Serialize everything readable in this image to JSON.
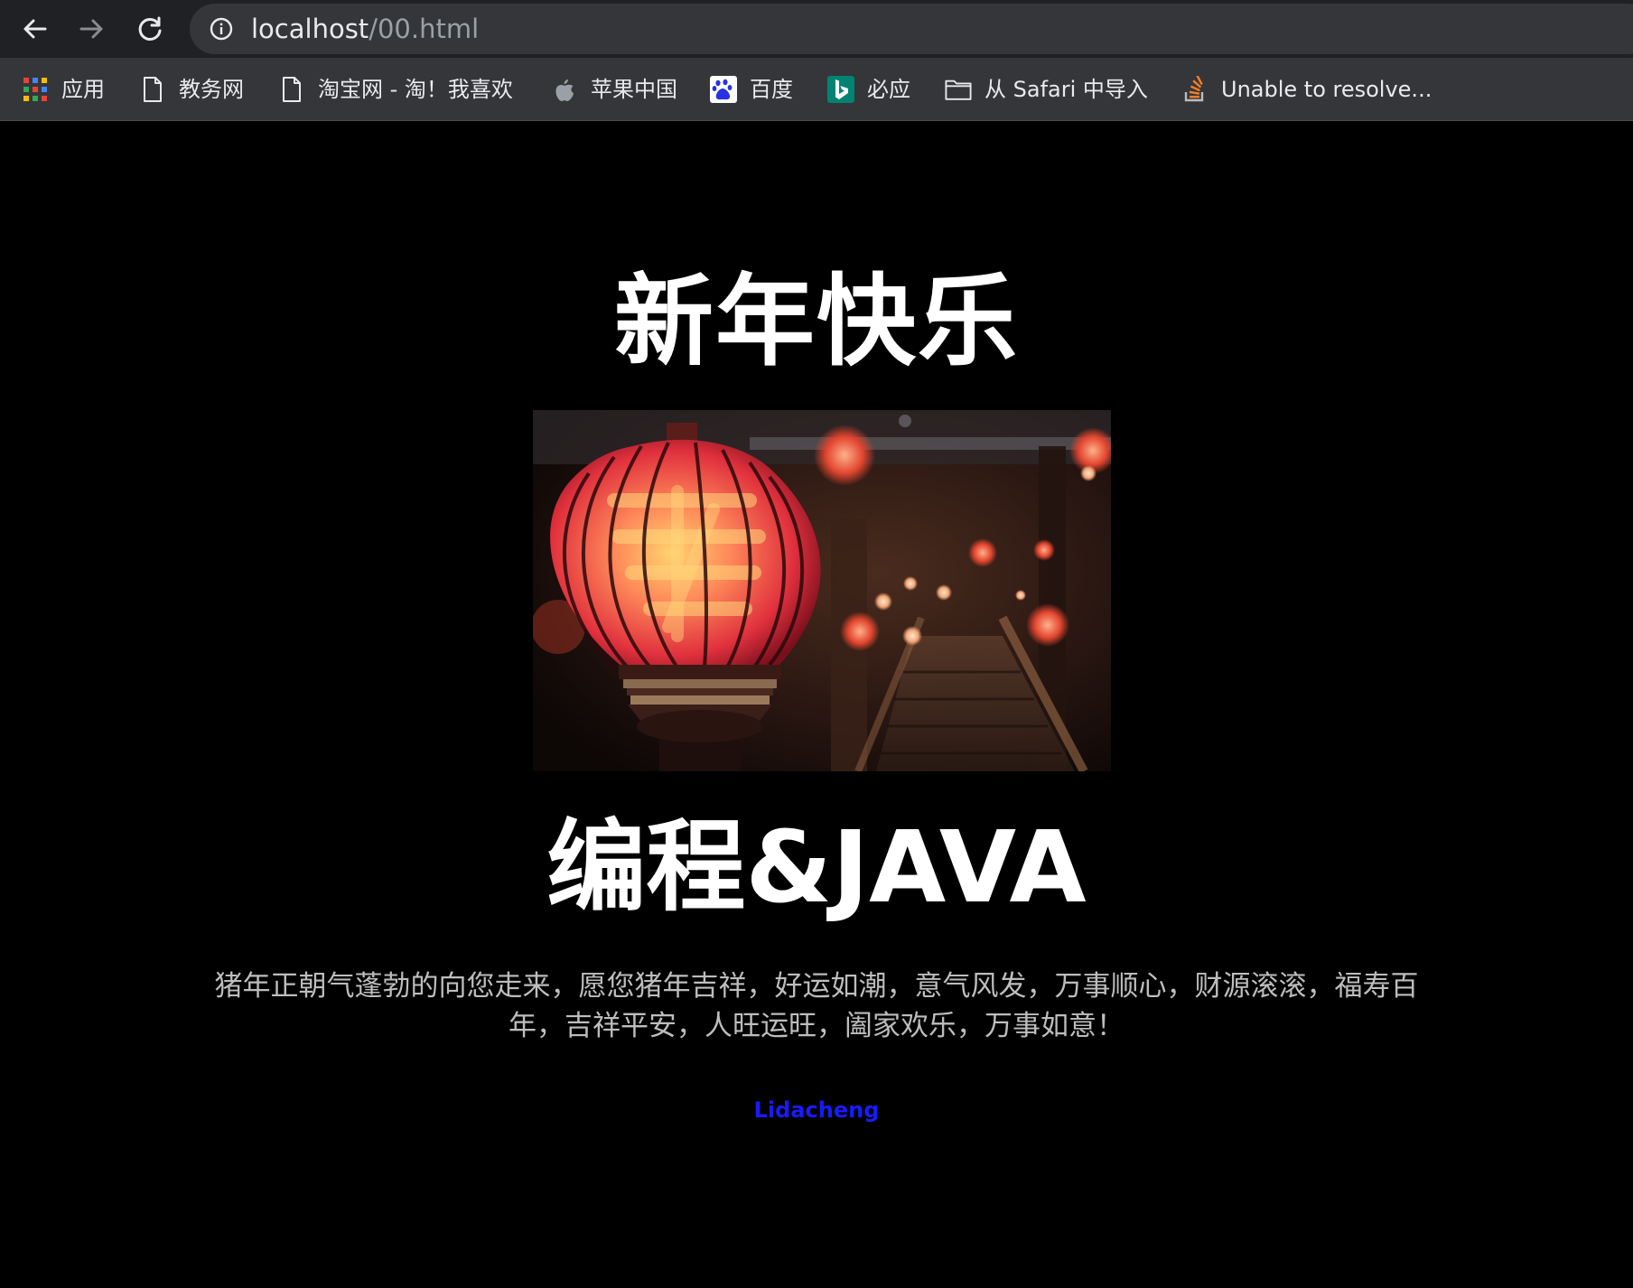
{
  "browser": {
    "url_host": "localhost",
    "url_path": "/00.html",
    "bookmarks": [
      {
        "label": "应用",
        "icon": "apps-grid-icon"
      },
      {
        "label": "教务网",
        "icon": "page-icon"
      },
      {
        "label": "淘宝网 - 淘！我喜欢",
        "icon": "page-icon"
      },
      {
        "label": "苹果中国",
        "icon": "apple-icon"
      },
      {
        "label": "百度",
        "icon": "baidu-icon"
      },
      {
        "label": "必应",
        "icon": "bing-icon"
      },
      {
        "label": "从 Safari 中导入",
        "icon": "folder-icon"
      },
      {
        "label": "Unable to resolve...",
        "icon": "stack-overflow-icon"
      }
    ]
  },
  "content": {
    "title": "新年快乐",
    "subtitle": "编程&JAVA",
    "blessing": "猪年正朝气蓬勃的向您走来，愿您猪年吉祥，好运如潮，意气风发，万事顺心，财源滚滚，福寿百年，吉祥平安，人旺运旺，阖家欢乐，万事如意！",
    "author": "Lidacheng",
    "photo_name": "red-lantern-photo"
  },
  "colors": {
    "page_background": "#000000",
    "title_text": "#ffffff",
    "body_text": "#bdbdbd",
    "link": "#1a1aff",
    "toolbar": "#202124",
    "bookmark_bar": "#35363a"
  }
}
